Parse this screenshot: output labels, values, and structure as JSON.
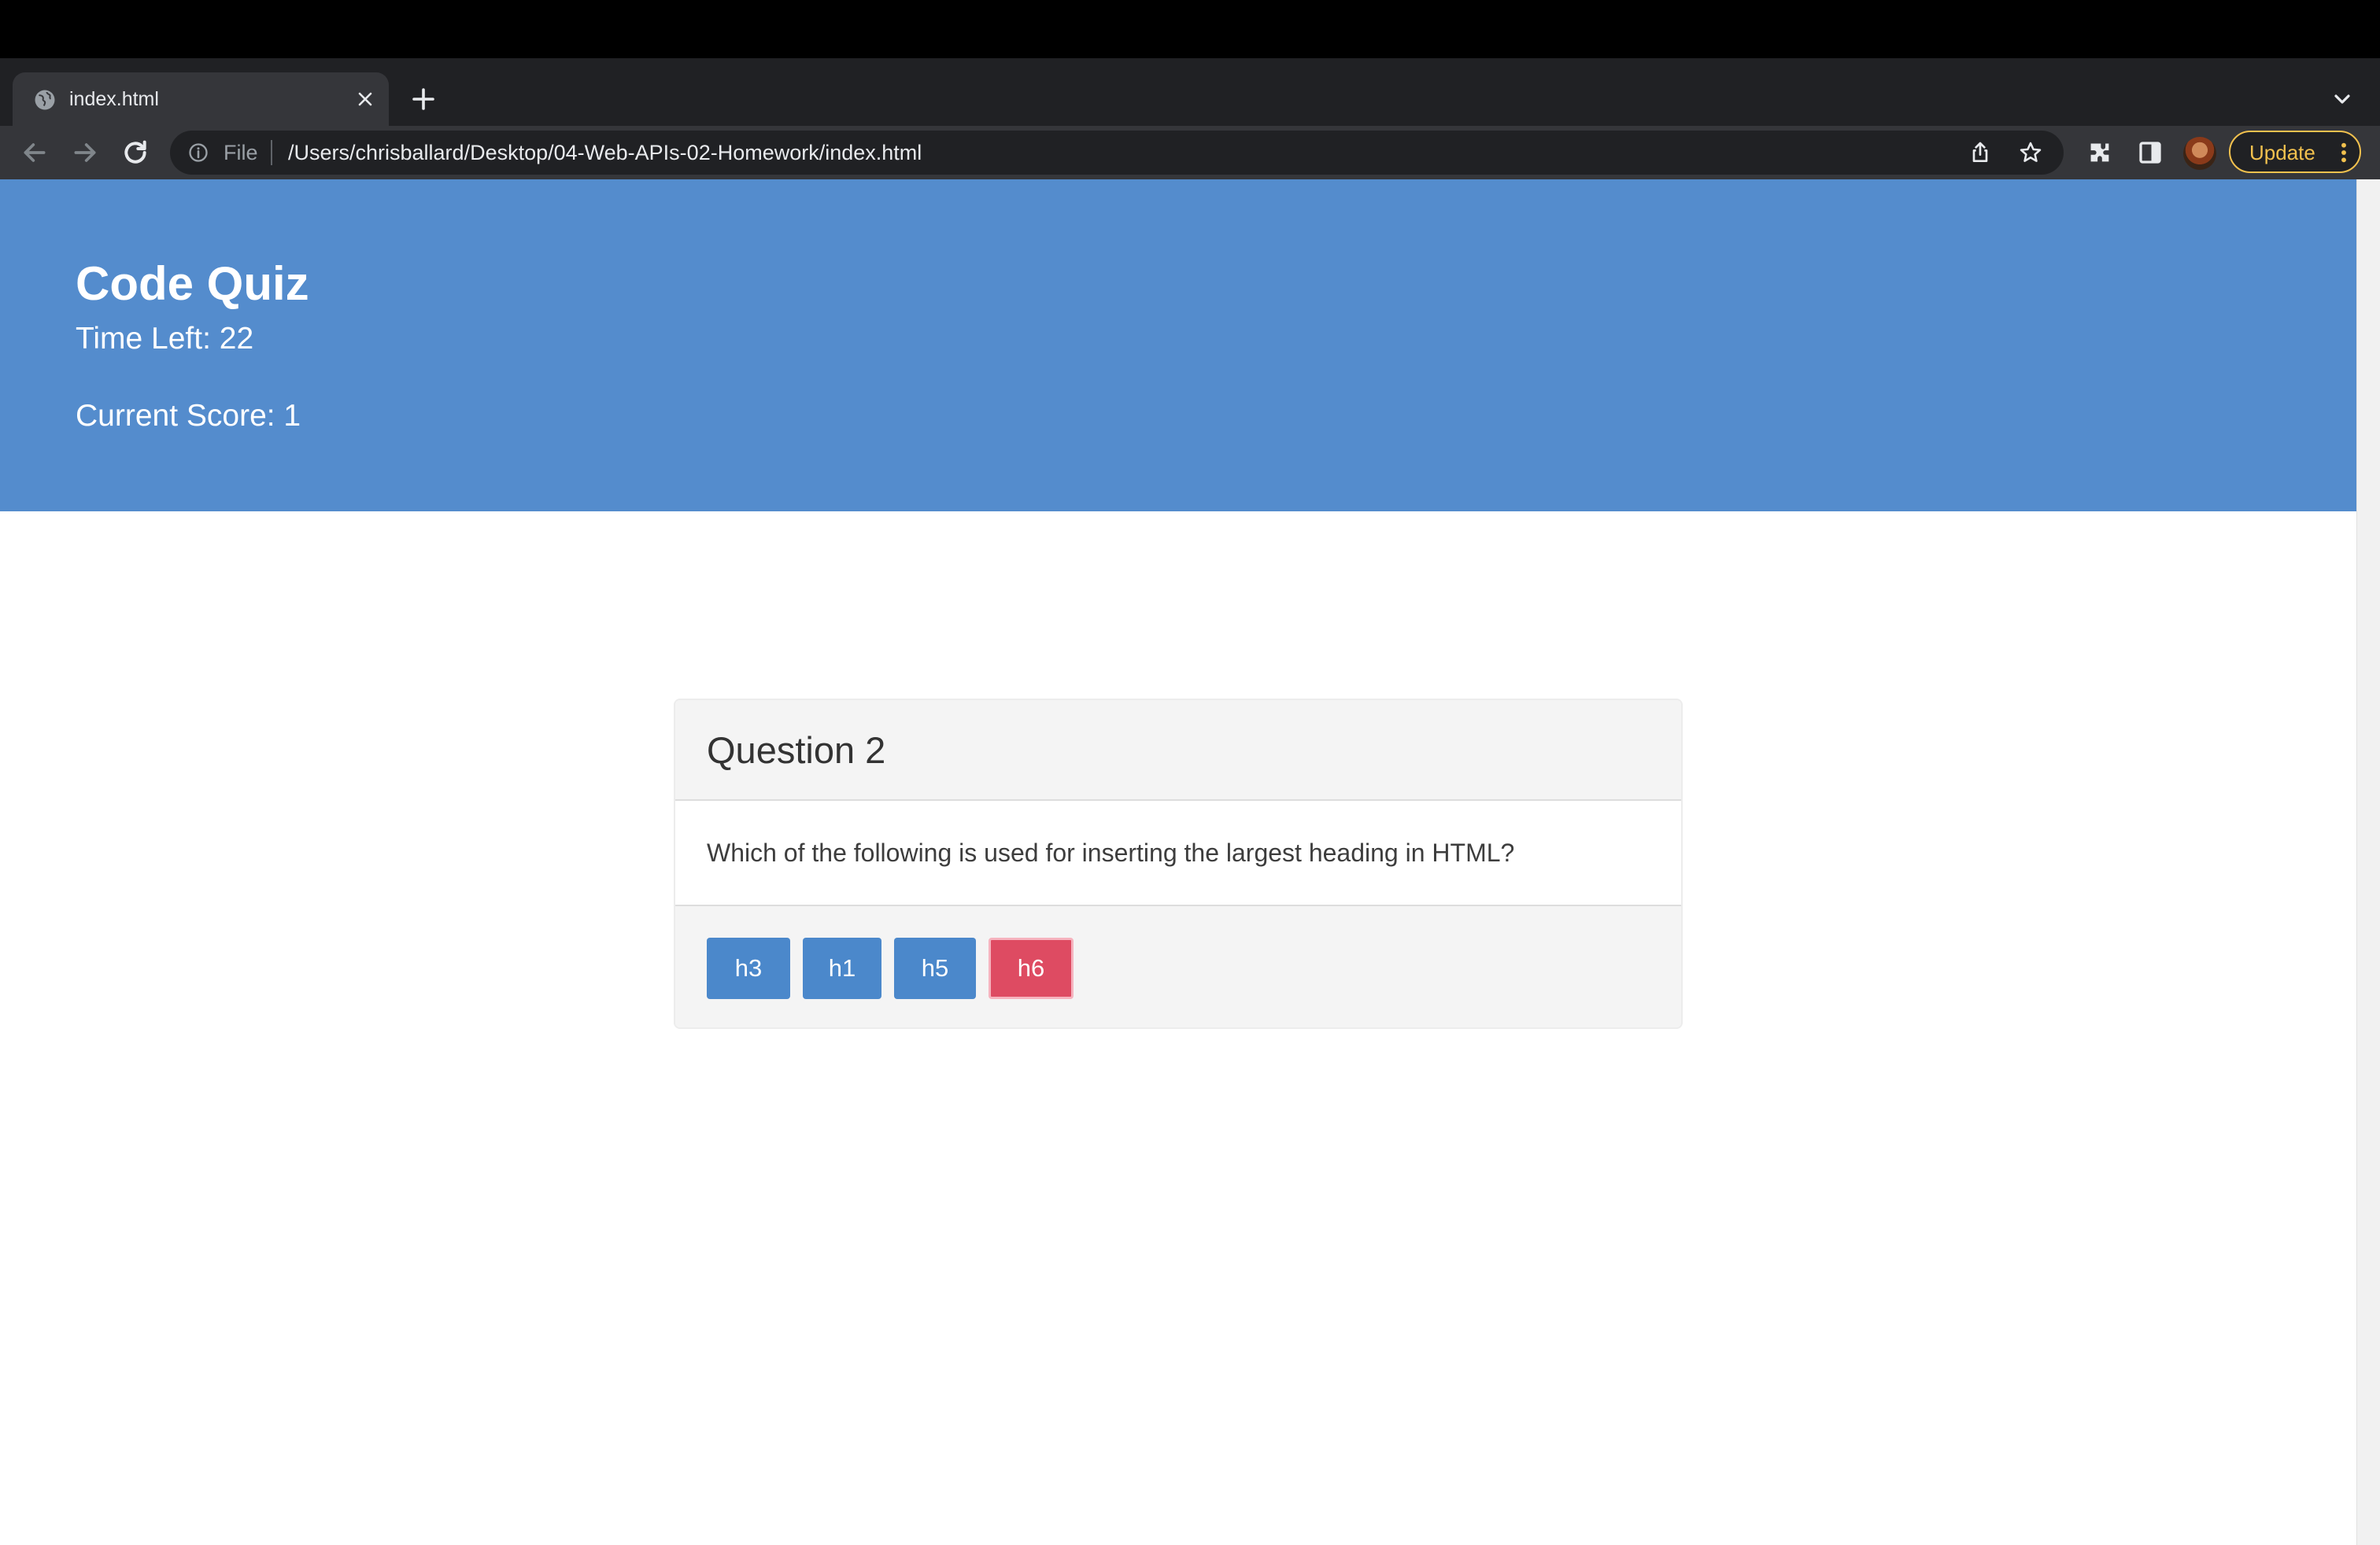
{
  "browser": {
    "tab": {
      "title": "index.html"
    },
    "omnibox": {
      "scheme_label": "File",
      "url": "/Users/chrisballard/Desktop/04-Web-APIs-02-Homework/index.html"
    },
    "update_button": {
      "label": "Update"
    },
    "icons": {
      "favicon": "globe-icon",
      "tab_close": "close-icon",
      "new_tab": "plus-icon",
      "tab_search": "chevron-down-icon",
      "back": "back-arrow-icon",
      "forward": "forward-arrow-icon",
      "reload": "reload-icon",
      "site_info": "info-icon",
      "share": "share-icon",
      "bookmark": "star-icon",
      "extensions": "puzzle-icon",
      "side_panel": "side-panel-icon",
      "menu": "kebab-menu-icon"
    }
  },
  "quiz": {
    "title": "Code Quiz",
    "time_left": "Time Left: 22",
    "current_score": "Current Score: 1"
  },
  "question": {
    "heading": "Question 2",
    "text": "Which of the following is used for inserting the largest heading in HTML?",
    "answers": [
      {
        "label": "h3",
        "state": "default"
      },
      {
        "label": "h1",
        "state": "default"
      },
      {
        "label": "h5",
        "state": "default"
      },
      {
        "label": "h6",
        "state": "incorrect"
      }
    ]
  },
  "colors": {
    "hero_background": "#548ccd",
    "answer_button": "#4b88cb",
    "answer_incorrect": "#de4b62",
    "update_accent": "#f2c14e"
  }
}
